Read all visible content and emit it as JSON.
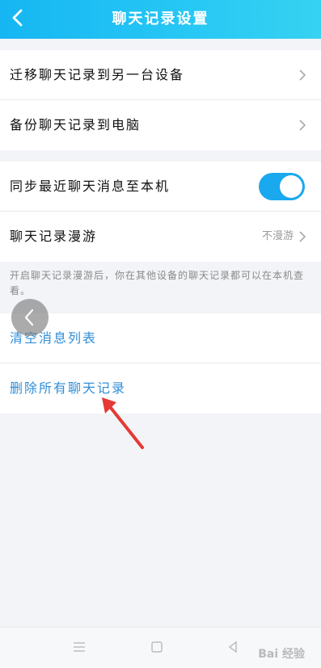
{
  "header": {
    "title": "聊天记录设置"
  },
  "group1": {
    "items": [
      {
        "label": "迁移聊天记录到另一台设备"
      },
      {
        "label": "备份聊天记录到电脑"
      }
    ]
  },
  "group2": {
    "sync": {
      "label": "同步最近聊天消息至本机",
      "enabled": true
    },
    "roaming": {
      "label": "聊天记录漫游",
      "value": "不漫游"
    }
  },
  "note": {
    "text": "开启聊天记录漫游后，你在其他设备的聊天记录都可以在本机查看。"
  },
  "group3": {
    "clear_list": "清空消息列表",
    "delete_all": "删除所有聊天记录"
  },
  "watermark": {
    "text": "Bai 经验"
  },
  "colors": {
    "header": "#16b6f3",
    "accent": "#1aa8ef",
    "link": "#2f8ed8",
    "annotation": "#e53935"
  }
}
